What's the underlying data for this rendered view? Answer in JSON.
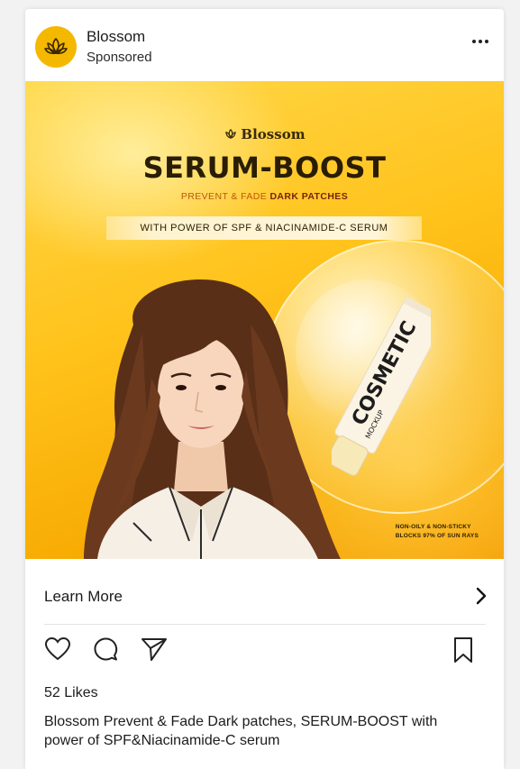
{
  "post": {
    "brand_name": "Blossom",
    "sponsored_label": "Sponsored",
    "avatar_icon": "lotus-icon",
    "more_icon": "more-horizontal-icon"
  },
  "ad": {
    "logo_text": "Blossom",
    "title": "SERUM-BOOST",
    "subtitle_light": "PREVENT & FADE ",
    "subtitle_bold": "DARK PATCHES",
    "banner": "WITH POWER OF SPF & NIACINAMIDE-C SERUM",
    "tube_text_main": "COSMETIC",
    "tube_text_small": "MOCKUP",
    "claim_line1": "NON-OILY & NON-STICKY",
    "claim_line2": "BLOCKS 97% OF SUN RAYS",
    "accent_color": "#ffc21a"
  },
  "cta": {
    "label": "Learn More",
    "icon": "chevron-right-icon"
  },
  "actions": {
    "like_icon": "heart-icon",
    "comment_icon": "comment-icon",
    "share_icon": "send-icon",
    "save_icon": "bookmark-icon"
  },
  "likes": "52 Likes",
  "caption": "Blossom Prevent & Fade Dark patches, SERUM-BOOST with power of SPF&Niacinamide-C serum"
}
